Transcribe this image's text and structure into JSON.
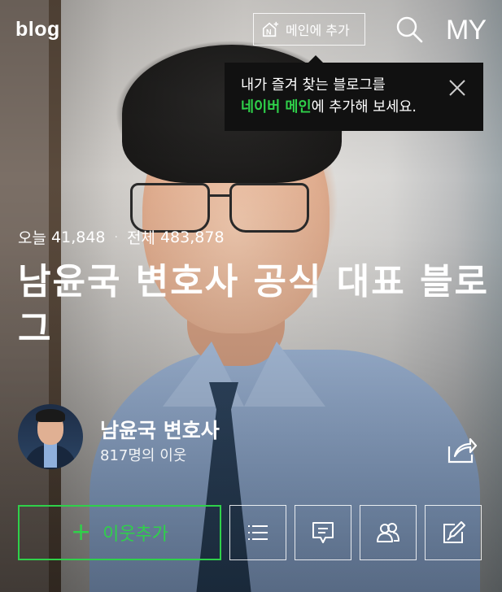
{
  "header": {
    "logo": "blog",
    "add_to_main_label": "메인에 추가",
    "search_icon": "search-icon",
    "my_label": "MY"
  },
  "tooltip": {
    "line1": "내가 즐겨 찾는 블로그를",
    "line2_highlight": "네이버 메인",
    "line2_rest": "에 추가해 보세요.",
    "highlight_color": "#2fd14a",
    "close_icon": "close-icon"
  },
  "stats": {
    "today_label": "오늘",
    "today_value": "41,848",
    "separator": "·",
    "total_label": "전체",
    "total_value": "483,878"
  },
  "blog": {
    "title": "남윤국 변호사 공식 대표 블로그"
  },
  "profile": {
    "name": "남윤국 변호사",
    "neighbors": "817명의 이웃",
    "share_icon": "share-icon"
  },
  "actions": {
    "add_neighbor_label": "이웃추가",
    "add_neighbor_icon": "plus-icon",
    "menu_icon": "list-icon",
    "guestbook_icon": "chat-bubble-icon",
    "neighbors_icon": "people-icon",
    "write_icon": "write-icon",
    "accent_color": "#2fd14a"
  }
}
